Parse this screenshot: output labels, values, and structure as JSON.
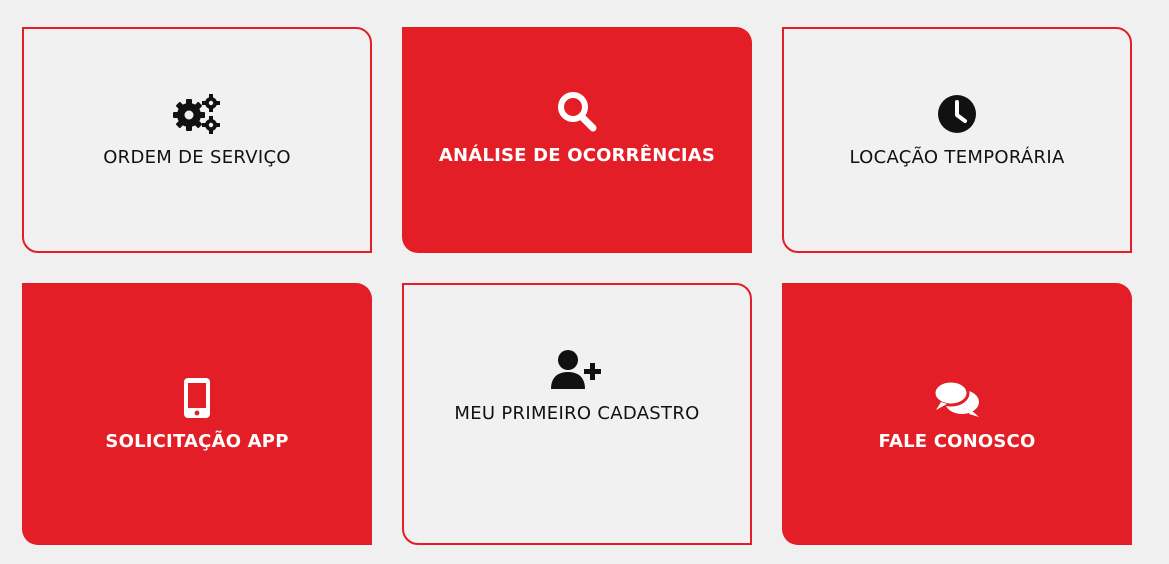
{
  "brand": {
    "accent": "#e31e26",
    "card_light_bg": "#f1f1f1",
    "page_bg": "#f0f0f0"
  },
  "cards": [
    {
      "label": "ORDEM DE SERVIÇO",
      "icon": "gears-icon",
      "style": "light"
    },
    {
      "label": "ANÁLISE DE OCORRÊNCIAS",
      "icon": "search-icon",
      "style": "red"
    },
    {
      "label": "LOCAÇÃO TEMPORÁRIA",
      "icon": "clock-icon",
      "style": "light"
    },
    {
      "label": "SOLICITAÇÃO APP",
      "icon": "mobile-phone-icon",
      "style": "red"
    },
    {
      "label": "MEU PRIMEIRO CADASTRO",
      "icon": "user-plus-icon",
      "style": "light"
    },
    {
      "label": "FALE CONOSCO",
      "icon": "chat-bubbles-icon",
      "style": "red"
    }
  ]
}
